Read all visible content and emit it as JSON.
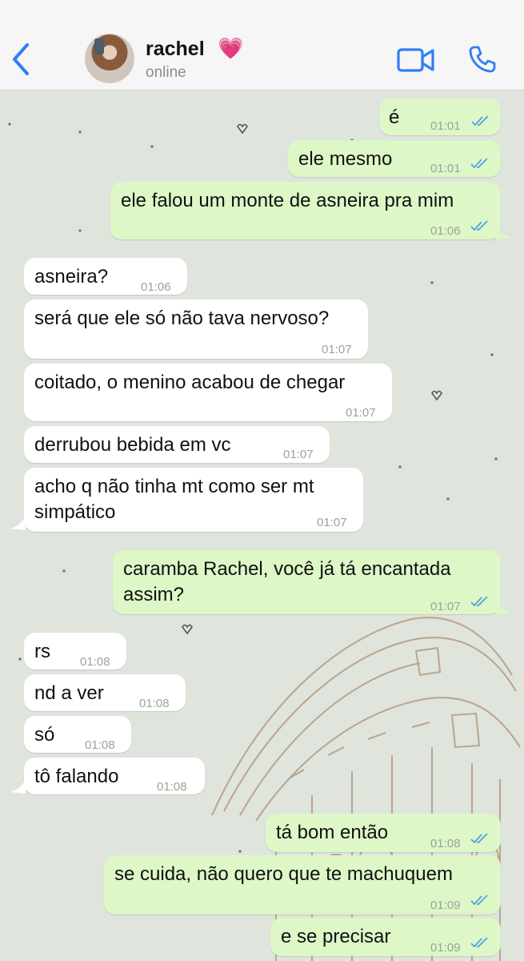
{
  "header": {
    "contact_name": "rachel",
    "contact_emoji": "💗",
    "status": "online",
    "icons": [
      "chevron-left-icon",
      "avatar-photo",
      "video-call-icon",
      "phone-call-icon"
    ],
    "accent_color": "#2f7ef6"
  },
  "messages": [
    {
      "dir": "out",
      "text": "é",
      "time": "01:01",
      "read": true
    },
    {
      "dir": "out",
      "text": "ele mesmo",
      "time": "01:01",
      "read": true
    },
    {
      "dir": "out",
      "text": "ele falou um monte de asneira pra mim",
      "time": "01:06",
      "read": true
    },
    {
      "dir": "in",
      "text": "asneira?",
      "time": "01:06"
    },
    {
      "dir": "in",
      "text": "será que ele só não tava nervoso?",
      "time": "01:07"
    },
    {
      "dir": "in",
      "text": "coitado, o menino acabou de chegar",
      "time": "01:07"
    },
    {
      "dir": "in",
      "text": "derrubou bebida em vc",
      "time": "01:07"
    },
    {
      "dir": "in",
      "text": "acho q não tinha mt como ser mt",
      "text2": "simpático",
      "time": "01:07"
    },
    {
      "dir": "out",
      "text": "caramba Rachel, você já tá encantada",
      "text2": "assim?",
      "time": "01:07",
      "read": true
    },
    {
      "dir": "in",
      "text": "rs",
      "time": "01:08"
    },
    {
      "dir": "in",
      "text": "nd a ver",
      "time": "01:08"
    },
    {
      "dir": "in",
      "text": "só",
      "time": "01:08"
    },
    {
      "dir": "in",
      "text": "tô falando",
      "time": "01:08"
    },
    {
      "dir": "out",
      "text": "tá bom então",
      "time": "01:08",
      "read": true
    },
    {
      "dir": "out",
      "text": "se cuida, não quero que te machuquem",
      "time": "01:09",
      "read": true
    },
    {
      "dir": "out",
      "text": "e se precisar",
      "time": "01:09",
      "read": true
    }
  ],
  "colors": {
    "outgoing_bubble": "#ddf7c7",
    "incoming_bubble": "#ffffff",
    "chat_background": "#dfe4dc",
    "read_ticks": "#4ea3e6"
  }
}
